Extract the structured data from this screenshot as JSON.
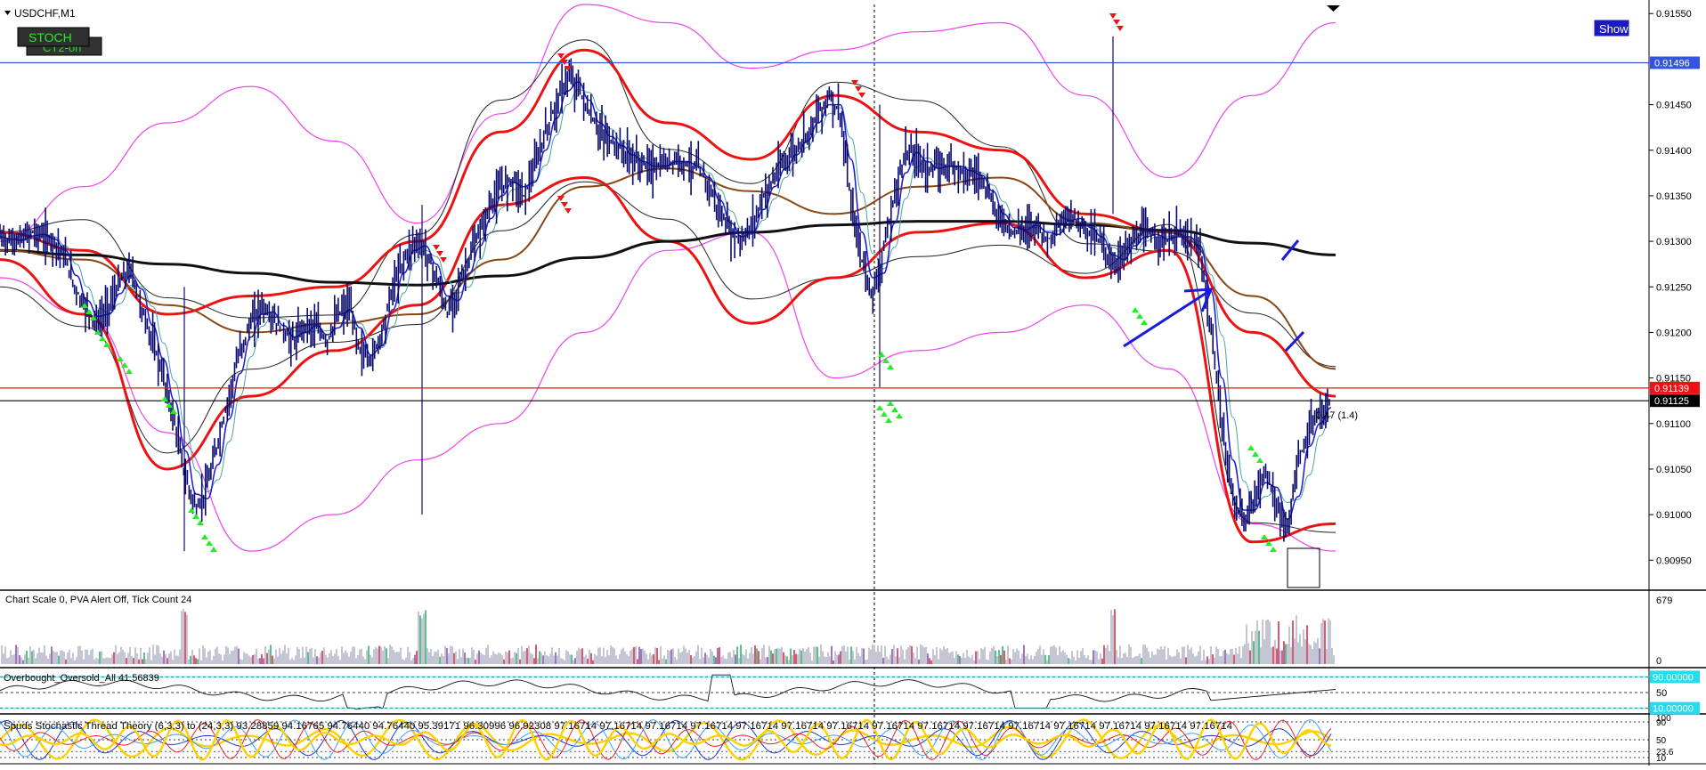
{
  "window": {
    "symbol_label": "USDCHF,M1",
    "menu_triangle": "triangle-down-icon"
  },
  "buttons": {
    "stoch": "STOCH",
    "stoch_sub": "CT2-on",
    "show": "Show"
  },
  "colors": {
    "candles": "#0a0a6e",
    "bb_outer": "#ee44ee",
    "bb_red": "#ee1111",
    "bb_inner": "#222222",
    "ma_long": "#111111",
    "ma_brown": "#8b4513",
    "ma_blue": "#1a1adb",
    "ma_teal": "#4aa3a3",
    "hline_blue": "#3355dd",
    "hline_red": "#ee1111",
    "hline_black": "#000000",
    "signal_green": "#22ee22",
    "signal_red": "#ee1111",
    "arrow_blue": "#1a1add"
  },
  "chart_data": [
    {
      "type": "line",
      "title": "USDCHF,M1",
      "y_axis": {
        "ticks": [
          "0.91550",
          "0.91450",
          "0.91400",
          "0.91350",
          "0.91300",
          "0.91250",
          "0.91200",
          "0.91150",
          "0.91100",
          "0.91050",
          "0.91000",
          "0.90950"
        ],
        "range": [
          0.9092,
          0.9156
        ]
      },
      "price_labels": [
        {
          "text": "0.91496",
          "value": 0.91496,
          "color": "blue"
        },
        {
          "text": "0.91139",
          "value": 0.91139,
          "color": "red"
        },
        {
          "text": "0.91125",
          "value": 0.91125,
          "color": "black"
        }
      ],
      "annotation": {
        "text": "0.47 (1.4)",
        "value": 0.91128
      },
      "price_path": [
        0.91305,
        0.913,
        0.91302,
        0.9131,
        0.91305,
        0.913,
        0.9128,
        0.91245,
        0.91225,
        0.9121,
        0.9123,
        0.91255,
        0.9127,
        0.91225,
        0.9119,
        0.9115,
        0.911,
        0.9104,
        0.91005,
        0.9103,
        0.9108,
        0.9113,
        0.9118,
        0.9121,
        0.9123,
        0.91215,
        0.912,
        0.9119,
        0.9121,
        0.91205,
        0.9119,
        0.9122,
        0.9123,
        0.9118,
        0.9117,
        0.912,
        0.9125,
        0.9128,
        0.913,
        0.9129,
        0.9126,
        0.9122,
        0.9125,
        0.9128,
        0.9131,
        0.9134,
        0.9136,
        0.9137,
        0.9135,
        0.9138,
        0.9142,
        0.9145,
        0.9148,
        0.9147,
        0.9144,
        0.9142,
        0.9141,
        0.914,
        0.9139,
        0.91385,
        0.9138,
        0.91385,
        0.9139,
        0.91385,
        0.9138,
        0.9136,
        0.9133,
        0.9131,
        0.913,
        0.9132,
        0.9135,
        0.9137,
        0.9139,
        0.914,
        0.9142,
        0.9144,
        0.9146,
        0.9144,
        0.9134,
        0.9128,
        0.9124,
        0.9129,
        0.9135,
        0.914,
        0.91395,
        0.9138,
        0.9138,
        0.91385,
        0.9138,
        0.91375,
        0.9137,
        0.9134,
        0.9132,
        0.9131,
        0.91315,
        0.9132,
        0.913,
        0.91315,
        0.9133,
        0.9132,
        0.9131,
        0.913,
        0.9127,
        0.9129,
        0.913,
        0.9131,
        0.91305,
        0.913,
        0.9131,
        0.913,
        0.9129,
        0.912,
        0.911,
        0.9102,
        0.9099,
        0.9102,
        0.9105,
        0.9101,
        0.9098,
        0.9106,
        0.9109,
        0.9111,
        0.91125
      ],
      "moving_averages": {
        "long_black": [
          0.9129,
          0.91285,
          0.91275,
          0.91265,
          0.91255,
          0.91252,
          0.91262,
          0.91282,
          0.913,
          0.9131,
          0.91318,
          0.91322,
          0.91322,
          0.91318,
          0.91312,
          0.91298,
          0.91285
        ],
        "brown": [
          0.9129,
          0.9128,
          0.9123,
          0.912,
          0.9121,
          0.9122,
          0.9128,
          0.9136,
          0.9138,
          0.91355,
          0.9133,
          0.9136,
          0.9137,
          0.9132,
          0.9131,
          0.9124,
          0.9116
        ]
      },
      "bands": {
        "magenta_upper": [
          0.913,
          0.9136,
          0.9143,
          0.9147,
          0.9141,
          0.9132,
          0.9144,
          0.9156,
          0.9154,
          0.9149,
          0.9151,
          0.9153,
          0.9154,
          0.9146,
          0.9137,
          0.9146,
          0.9154
        ],
        "magenta_lower": [
          0.9126,
          0.9122,
          0.9109,
          0.9096,
          0.91,
          0.9106,
          0.911,
          0.912,
          0.9129,
          0.9131,
          0.9115,
          0.9118,
          0.912,
          0.9123,
          0.9116,
          0.9099,
          0.9096
        ],
        "red_upper": [
          0.9131,
          0.9129,
          0.9122,
          0.9124,
          0.9125,
          0.913,
          0.9142,
          0.9151,
          0.9143,
          0.9139,
          0.9146,
          0.9142,
          0.914,
          0.9133,
          0.9131,
          0.912,
          0.9113
        ],
        "red_lower": [
          0.9128,
          0.9122,
          0.9105,
          0.9113,
          0.9118,
          0.9123,
          0.9134,
          0.9137,
          0.913,
          0.9121,
          0.9126,
          0.9131,
          0.9132,
          0.9126,
          0.9129,
          0.9097,
          0.9099
        ]
      },
      "signals": {
        "green_up": [
          "~0.91250",
          "~0.91150",
          "~0.91040",
          "~0.91240",
          "~0.91130",
          "~0.91260",
          "~0.91000"
        ],
        "red_down": [
          "~0.91480",
          "~0.91360",
          "~0.91300",
          "~0.91480"
        ]
      },
      "grid": false,
      "vertical_marker": "dashed crosshair"
    },
    {
      "type": "bar",
      "title": "Chart Scale 0,  PVA Alert Off,  Tick Count 24",
      "y_axis": {
        "ticks": [
          "679",
          "0"
        ],
        "range": [
          0,
          679
        ]
      },
      "series": [
        {
          "values_summary": "tick volume histogram, grey with red/green/purple spikes; peaks near 679"
        }
      ]
    },
    {
      "type": "line",
      "title": "Overbought_Oversold_All 41.56839",
      "y_axis": {
        "ticks": [
          "90.00000",
          "50",
          "10.00000"
        ],
        "range": [
          0,
          100
        ]
      },
      "levels": [
        90,
        50,
        10
      ]
    },
    {
      "type": "area",
      "title": "Spuds Stochastic Thread Theory (6,3,3) to (24,3,3) 93.28859 94.16765 94.76440 94.76440 95.39171 96.30996 96.92308 97.16714 97.16714 97.16714 97.16714 97.16714 97.16714 97.16714 97.16714 97.16714 97.16714 97.16714 97.16714 97.16714 97.16714 97.16714",
      "y_axis": {
        "ticks": [
          "100",
          "90",
          "50",
          "23.6",
          "10"
        ],
        "range": [
          0,
          100
        ]
      }
    }
  ],
  "volume_label": "Chart Scale 0,  PVA Alert Off,  Tick Count 24",
  "oo_label": "Overbought_Oversold_All 41.56839",
  "stoch_label": "Spuds Stochastic Thread Theory (6,3,3) to (24,3,3) 93.28859 94.16765 94.76440 94.76440 95.39171 96.30996 96.92308 97.16714 97.16714 97.16714 97.16714 97.16714 97.16714 97.16714 97.16714 97.16714 97.16714 97.16714 97.16714 97.16714 97.16714 97.16714"
}
